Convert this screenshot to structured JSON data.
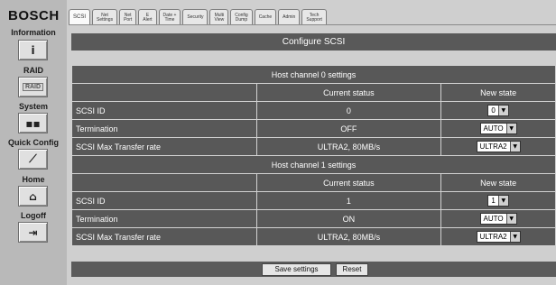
{
  "brand": "BOSCH",
  "sidebar": {
    "items": [
      {
        "label": "Information",
        "icon": "info-icon",
        "glyph": "i"
      },
      {
        "label": "RAID",
        "icon": "raid-icon",
        "glyph": "RAID"
      },
      {
        "label": "System",
        "icon": "system-icon",
        "glyph": "▪▪"
      },
      {
        "label": "Quick Config",
        "icon": "quick-config-icon",
        "glyph": "⟋"
      },
      {
        "label": "Home",
        "icon": "home-icon",
        "glyph": "⌂"
      },
      {
        "label": "Logoff",
        "icon": "logoff-icon",
        "glyph": "⇥"
      }
    ]
  },
  "tabs": [
    "SCSI",
    "Net\nSettings",
    "Net\nPort",
    "E\nAlert",
    "Date +\nTime",
    "Security",
    "Multi\nView",
    "Config\nDump",
    "Cache",
    "Admin",
    "Tech\nSupport"
  ],
  "page_title": "Configure SCSI",
  "channels": [
    {
      "title": "Host channel 0 settings",
      "col_current": "Current status",
      "col_new": "New state",
      "rows": [
        {
          "label": "SCSI ID",
          "current": "0",
          "select": "0"
        },
        {
          "label": "Termination",
          "current": "OFF",
          "select": "AUTO"
        },
        {
          "label": "SCSI Max Transfer rate",
          "current": "ULTRA2, 80MB/s",
          "select": "ULTRA2"
        }
      ]
    },
    {
      "title": "Host channel 1 settings",
      "col_current": "Current status",
      "col_new": "New state",
      "rows": [
        {
          "label": "SCSI ID",
          "current": "1",
          "select": "1"
        },
        {
          "label": "Termination",
          "current": "ON",
          "select": "AUTO"
        },
        {
          "label": " SCSI Max Transfer rate",
          "current": "ULTRA2, 80MB/s",
          "select": "ULTRA2"
        }
      ]
    }
  ],
  "buttons": {
    "save": "Save settings",
    "reset": "Reset"
  }
}
